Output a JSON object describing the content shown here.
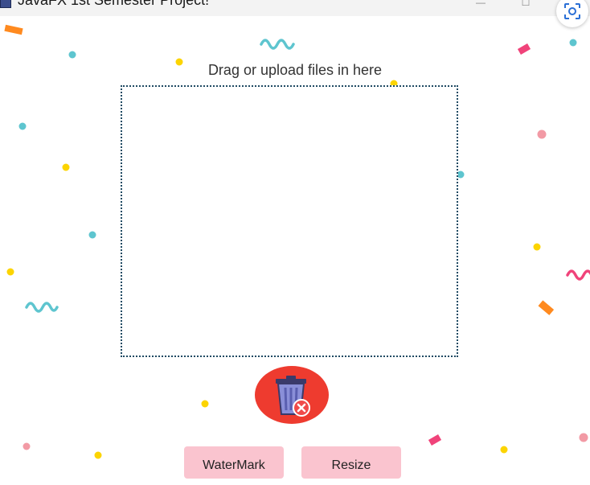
{
  "window": {
    "title": "JavaFX 1st Semester Project!"
  },
  "upload": {
    "prompt": "Drag or upload files in here"
  },
  "buttons": {
    "watermark_label": "WaterMark",
    "resize_label": "Resize"
  },
  "icons": {
    "trash": "trash-delete-icon",
    "screenshot": "screenshot-capture-icon",
    "app": "javafx-app-icon"
  },
  "colors": {
    "trash_button_bg": "#ee3b2f",
    "action_button_bg": "#fac4cf",
    "drop_zone_border": "#1f4a63",
    "confetti_teal": "#5ec5cf",
    "confetti_yellow": "#fcd400",
    "confetti_pink": "#f0437a",
    "confetti_orange": "#ff8a1f"
  }
}
